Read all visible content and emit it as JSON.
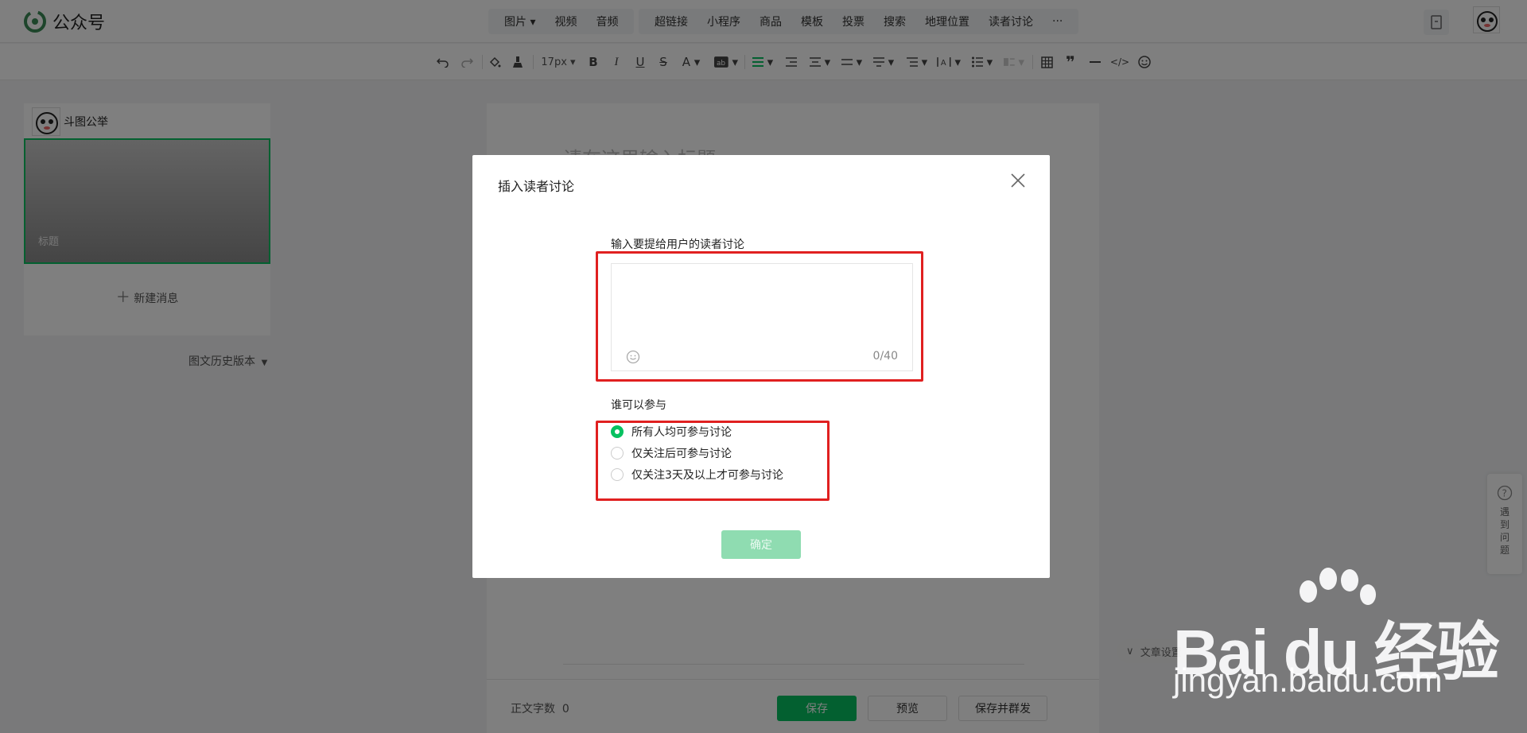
{
  "brand": {
    "name": "公众号",
    "accent": "#07c160"
  },
  "top_menu": {
    "group1": [
      "图片",
      "视频",
      "音频"
    ],
    "group2": [
      "超链接",
      "小程序",
      "商品",
      "模板",
      "投票",
      "搜索",
      "地理位置",
      "读者讨论"
    ],
    "more": "···"
  },
  "toolbar": {
    "font_size": "17px"
  },
  "left_panel": {
    "account_name": "斗图公举",
    "cover_title": "标题",
    "new_message": "新建消息",
    "history": "图文历史版本"
  },
  "editor": {
    "title_placeholder": "请在这里输入标题",
    "word_count_label": "正文字数",
    "word_count": "0",
    "save": "保存",
    "preview": "预览",
    "save_publish": "保存并群发",
    "article_settings": "文章设置"
  },
  "help": {
    "label": "遇到问题"
  },
  "modal": {
    "title": "插入读者讨论",
    "input_label": "输入要提给用户的读者讨论",
    "input_value": "",
    "counter": "0/40",
    "who_label": "谁可以参与",
    "options": [
      "所有人均可参与讨论",
      "仅关注后可参与讨论",
      "仅关注3天及以上才可参与讨论"
    ],
    "selected_index": 0,
    "confirm": "确定"
  },
  "watermark": {
    "logo": "Bai du 经验",
    "url": "jingyan.baidu.com"
  }
}
